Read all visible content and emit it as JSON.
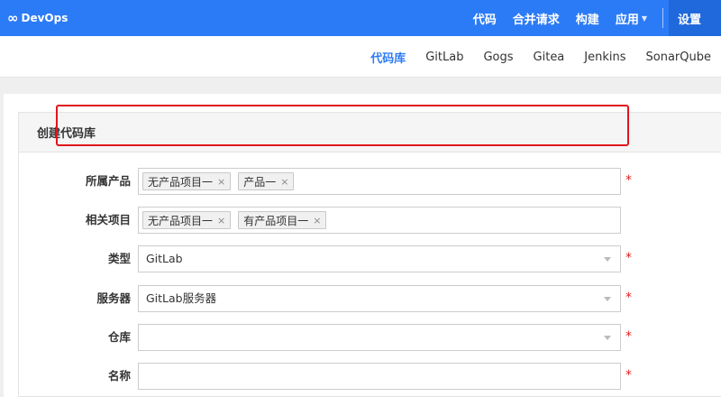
{
  "topbar": {
    "logo_text": "DevOps",
    "nav": [
      {
        "label": "代码"
      },
      {
        "label": "合并请求"
      },
      {
        "label": "构建"
      },
      {
        "label": "应用"
      }
    ],
    "settings_label": "设置"
  },
  "subnav": {
    "items": [
      {
        "label": "代码库",
        "active": true
      },
      {
        "label": "GitLab"
      },
      {
        "label": "Gogs"
      },
      {
        "label": "Gitea"
      },
      {
        "label": "Jenkins"
      },
      {
        "label": "SonarQube"
      }
    ]
  },
  "form": {
    "title": "创建代码库",
    "product": {
      "label": "所属产品",
      "tags": [
        "无产品项目一",
        "产品一"
      ]
    },
    "project": {
      "label": "相关项目",
      "tags": [
        "无产品项目一",
        "有产品项目一"
      ]
    },
    "type": {
      "label": "类型",
      "value": "GitLab"
    },
    "server": {
      "label": "服务器",
      "value": "GitLab服务器"
    },
    "repo": {
      "label": "仓库",
      "value": ""
    },
    "name": {
      "label": "名称",
      "value": ""
    },
    "required_mark": "*",
    "tag_remove": "×"
  },
  "colors": {
    "primary": "#2c7bf6",
    "highlight": "#e0161b",
    "required": "#e02020"
  }
}
